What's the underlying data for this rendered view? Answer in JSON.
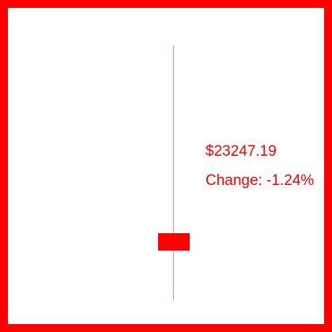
{
  "ticker": {
    "price_text": "$23247.19",
    "change_text": "Change: -1.24%",
    "trend": "down"
  },
  "colors": {
    "accent": "#ff0000",
    "background": "#ffffff"
  }
}
